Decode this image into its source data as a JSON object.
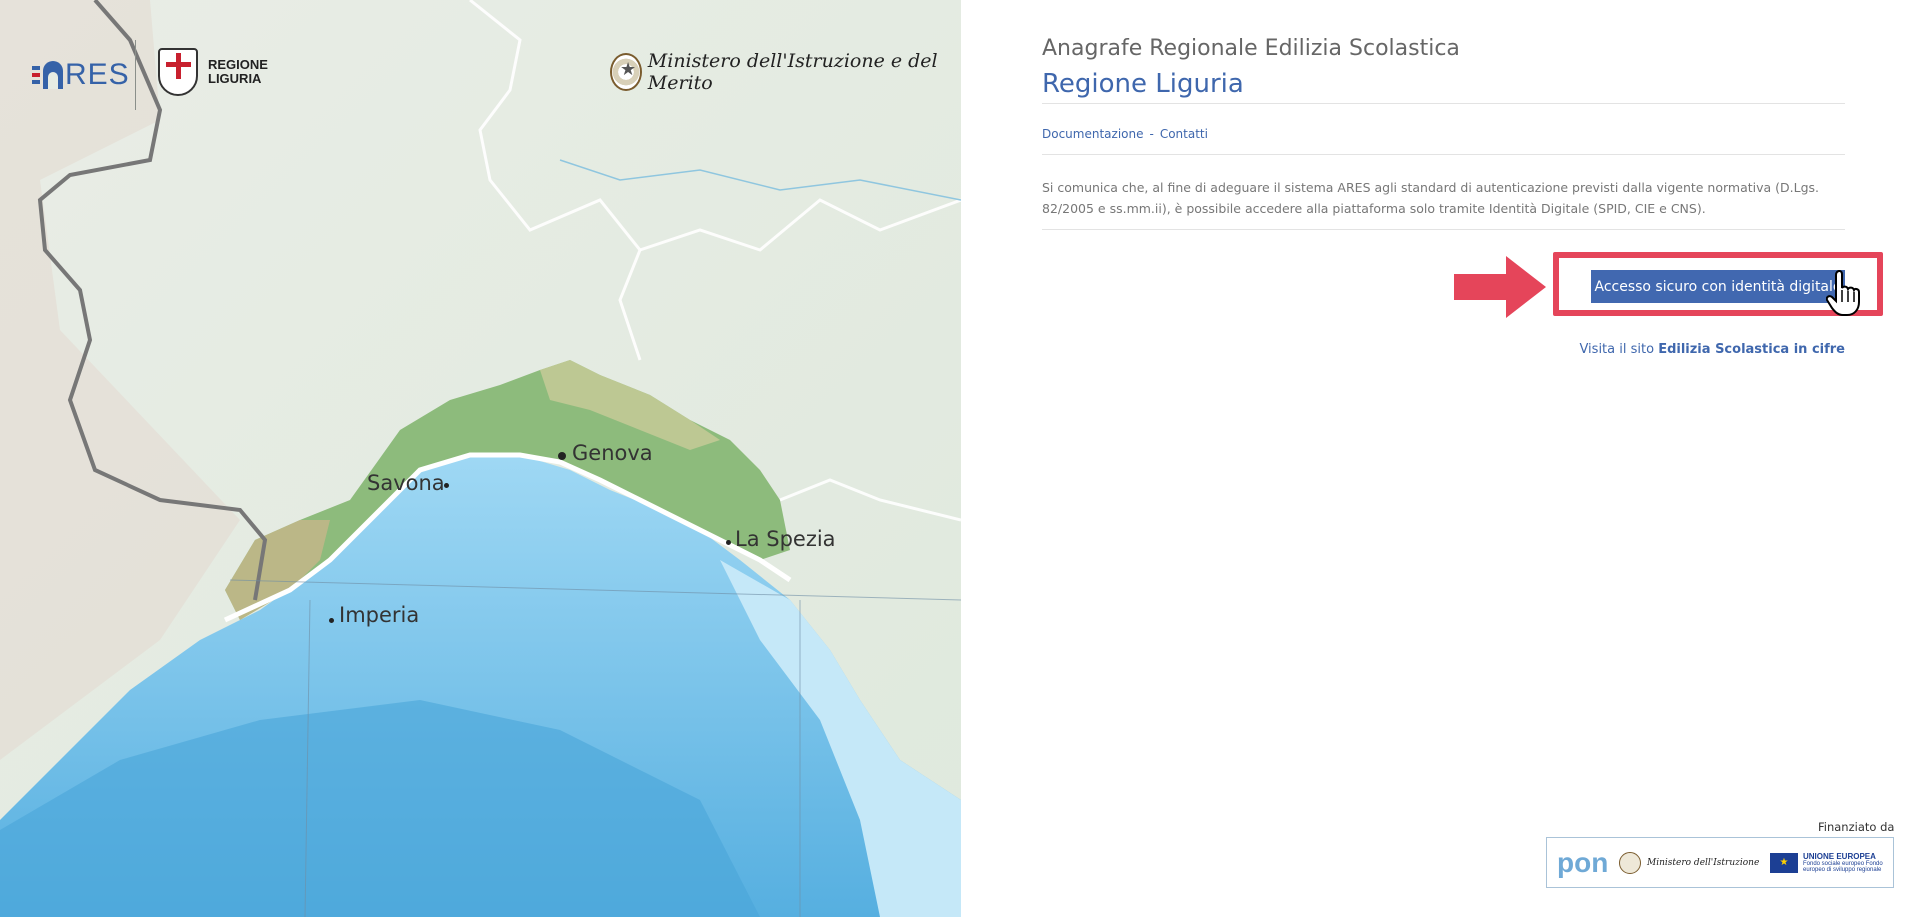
{
  "map": {
    "cities": [
      "Genova",
      "Savona",
      "La Spezia",
      "Imperia"
    ]
  },
  "logos": {
    "ares": "RES",
    "regione_line1": "REGIONE",
    "regione_line2": "LIGURIA",
    "ministero": "Ministero dell'Istruzione e del Merito"
  },
  "header": {
    "subtitle": "Anagrafe Regionale Edilizia Scolastica",
    "title": "Regione Liguria"
  },
  "nav": {
    "documentazione": "Documentazione",
    "separator": "-",
    "contatti": "Contatti"
  },
  "notice": "Si comunica che, al fine di adeguare il sistema ARES agli standard di autenticazione previsti dalla vigente normativa (D.Lgs. 82/2005 e ss.mm.ii), è possibile accedere alla piattaforma solo tramite Identità Digitale (SPID, CIE e CNS).",
  "login": {
    "button_label": "Accesso sicuro con identità digitale"
  },
  "visit": {
    "prefix": "Visita il sito",
    "link": "Edilizia Scolastica in cifre"
  },
  "footer": {
    "funded_by": "Finanziato da",
    "pon": "pon",
    "ministero": "Ministero dell'Istruzione",
    "eu_title": "UNIONE EUROPEA",
    "eu_sub": "Fondo sociale europeo Fondo europeo di sviluppo regionale"
  },
  "colors": {
    "brand_blue": "#3f67ad",
    "highlight_red": "#e5455a",
    "sea": "#7cc4ec",
    "land": "#e6ece3",
    "liguria_green": "#8dbb7c"
  }
}
